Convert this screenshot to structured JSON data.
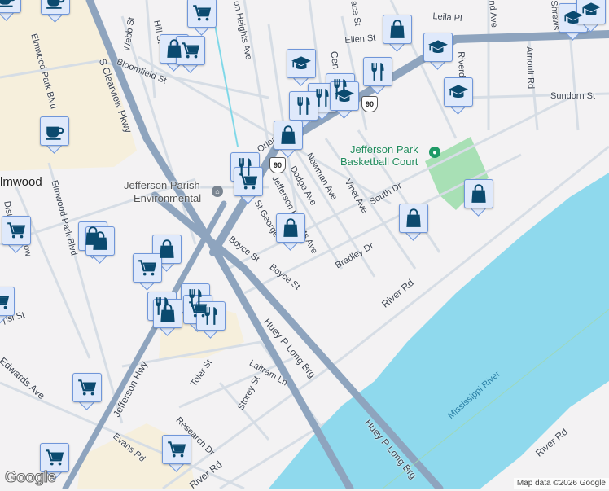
{
  "map": {
    "colors": {
      "background": "#f3f2f3",
      "water": "#8fd9ed",
      "park": "#a8e0b5",
      "commercial": "#f6efdc",
      "highway": "#8ea4be",
      "road": "#d6dde5",
      "marker_bg": "#dfe9fb",
      "marker_border": "#6f96d9",
      "icon": "#0b4a6f"
    },
    "labels": {
      "elmwood": "lmwood",
      "elmwood_park_blvd_1": "Elmwood Park Blvd",
      "elmwood_park_blvd_2": "Elmwood Park Blvd",
      "s_clearview_pkwy": "S Clearview Pkwy",
      "webb_st": "Webb St",
      "hill_st": "Hill St",
      "bloomfield_st": "Bloomfield St",
      "heights_ave": "on Heights Ave",
      "ellen_st": "Ellen St",
      "leila_pl": "Leila Pl",
      "ace_st": "ace St",
      "cen": "Cen",
      "riverd": "Riverd",
      "arnoult_rd": "Arnoult Rd",
      "sundorn_st": "Sundorn St",
      "shrews": "Shrews",
      "nd_ave": "nd Ave",
      "orleans": "Orlea",
      "jefferson_parish": "Jefferson Parish",
      "environmental": "Environmental",
      "jefferson_park": "Jefferson Park",
      "basketball_court": "Basketball Court",
      "newman_ave": "Newman Ave",
      "dodge_ave": "Dodge Ave",
      "jefferson_heights_ave": "Jefferson Heights Ave",
      "vinet_ave": "Vinet Ave",
      "south_dr": "South Dr",
      "st_george": "St George",
      "boyce_st_1": "Boyce St",
      "boyce_st_2": "Boyce St",
      "bradley_dr": "Bradley Dr",
      "river_rd_1": "River Rd",
      "river_rd_2": "River Rd",
      "river_rd_3": "River Rd",
      "distrib": "Distrib",
      "ow": "ow",
      "pepsi_st": "psi St",
      "edwards_ave": "Edwards Ave",
      "jefferson_hwy": "Jefferson Hwy",
      "huey_p_long_brg_1": "Huey P Long Brg",
      "huey_p_long_brg_2": "Huey P Long Brg",
      "mississippi_river": "Mississippi River",
      "toler_st": "Toler St",
      "storey_st": "Storey St",
      "laitram_ln": "Laitram Ln",
      "research_dr": "Research Dr",
      "evans_rd": "Evans Rd",
      "us90_1": "90",
      "us90_2": "90"
    },
    "markers": [
      "cafe",
      "cafe",
      "shopping-cart",
      "shopping-bag",
      "shopping-cart",
      "school",
      "shopping-bag",
      "school",
      "restaurant",
      "restaurant",
      "restaurant",
      "school",
      "restaurant",
      "school",
      "school",
      "school",
      "shopping-bag",
      "restaurant",
      "shopping-cart",
      "shopping-bag",
      "shopping-bag",
      "shopping-bag",
      "cafe",
      "shopping-cart",
      "shopping-bag",
      "shopping-bag",
      "shopping-bag",
      "shopping-cart",
      "shopping-cart",
      "restaurant",
      "restaurant",
      "shopping-cart",
      "shopping-bag",
      "restaurant",
      "shopping-cart",
      "shopping-cart",
      "shopping-cart"
    ],
    "google_logo": "Google",
    "attribution": "Map data ©2026 Google"
  }
}
